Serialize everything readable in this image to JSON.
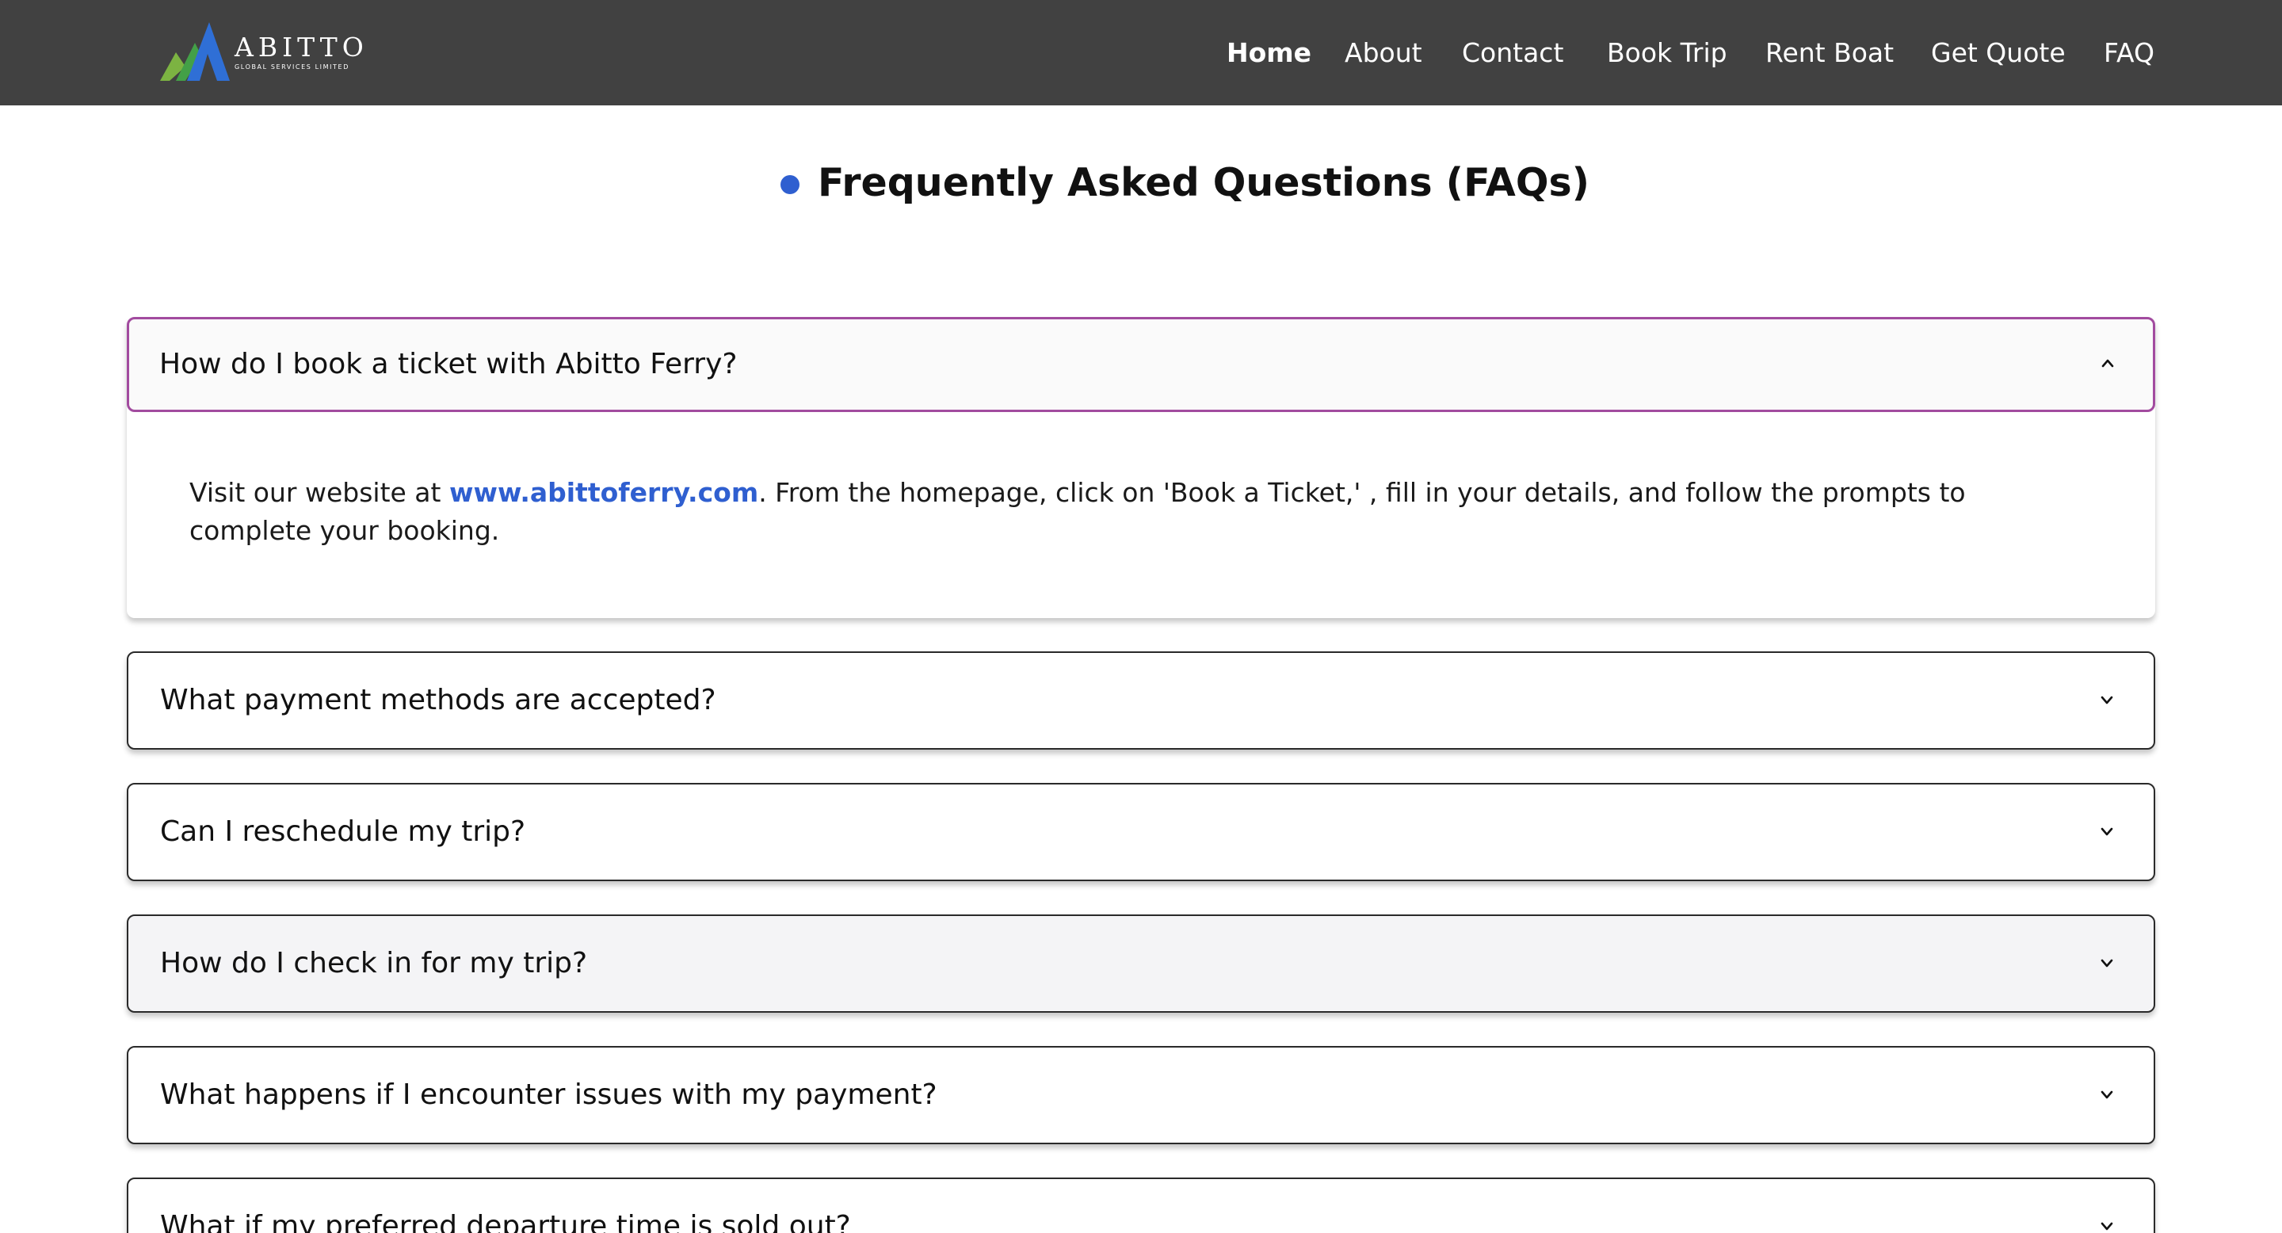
{
  "brand": {
    "name": "ABITTO",
    "tagline": "GLOBAL SERVICES LIMITED"
  },
  "nav": {
    "items": [
      "Home",
      "About",
      "Contact",
      "Book Trip",
      "Rent Boat",
      "Get Quote",
      "FAQ"
    ],
    "active": "Home"
  },
  "page": {
    "title": "Frequently Asked Questions (FAQs)"
  },
  "faqs": [
    {
      "question": "How do I book a ticket with Abitto Ferry?",
      "expanded": true,
      "answer_before": "Visit our website at ",
      "answer_link": "www.abittoferry.com",
      "answer_after": ". From the homepage, click on 'Book a Ticket,' , fill in your details, and follow the prompts to complete your booking."
    },
    {
      "question": "What payment methods are accepted?",
      "expanded": false
    },
    {
      "question": "Can I reschedule my trip?",
      "expanded": false
    },
    {
      "question": "How do I check in for my trip?",
      "expanded": false
    },
    {
      "question": "What happens if I encounter issues with my payment?",
      "expanded": false
    },
    {
      "question": "What if my preferred departure time is sold out?",
      "expanded": false
    }
  ],
  "icons": {
    "expanded": "chevron-up-icon",
    "collapsed": "chevron-down-icon"
  },
  "colors": {
    "navbar": "#414141",
    "accent": "#2f5fd0",
    "active_border": "#a24b9f"
  }
}
